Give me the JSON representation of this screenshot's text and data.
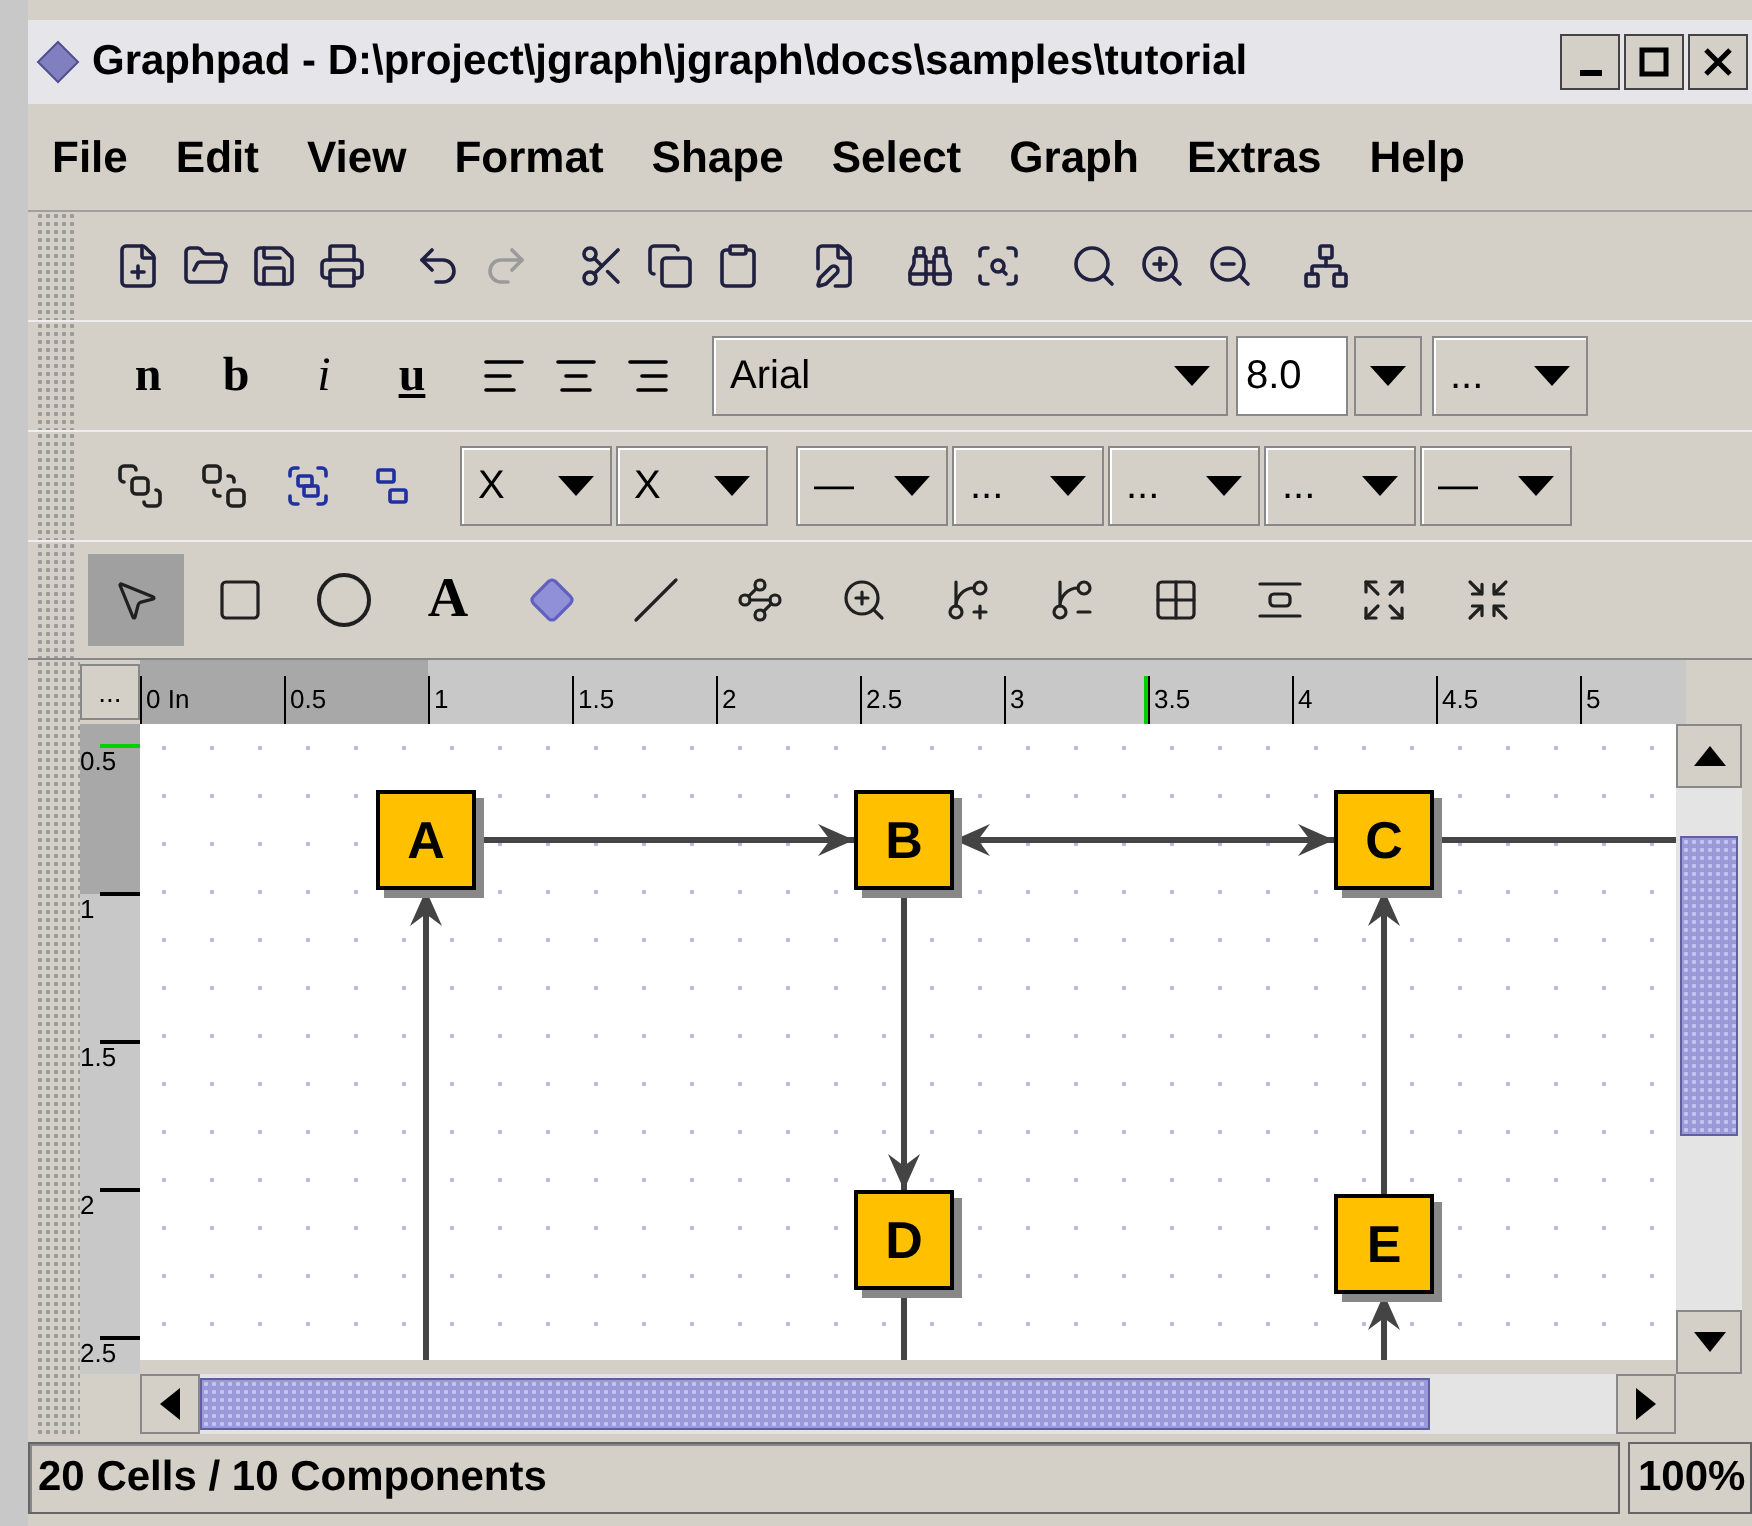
{
  "window": {
    "title": "Graphpad - D:\\project\\jgraph\\jgraph\\docs\\samples\\tutorial"
  },
  "menu": [
    "File",
    "Edit",
    "View",
    "Format",
    "Shape",
    "Select",
    "Graph",
    "Extras",
    "Help"
  ],
  "main_toolbar": [
    {
      "disabled": false
    },
    {
      "disabled": false
    },
    {
      "disabled": false
    },
    {
      "disabled": false
    },
    {
      "disabled": false
    },
    {
      "disabled": true
    },
    {
      "disabled": false
    },
    {
      "disabled": false
    },
    {
      "disabled": false
    },
    {
      "disabled": false
    },
    {
      "disabled": false
    },
    {
      "disabled": false
    },
    {
      "disabled": false
    },
    {
      "disabled": false
    },
    {
      "disabled": false
    },
    {
      "disabled": false
    }
  ],
  "format_toolbar": {
    "styles": [
      "n",
      "b",
      "i",
      "u"
    ],
    "font": "Arial",
    "size": "8.0",
    "size_more": "..."
  },
  "arrange_toolbar": {
    "combos": [
      "X",
      "X",
      "—",
      "...",
      "...",
      "...",
      "—"
    ]
  },
  "tools": [
    {
      "kind": "icon",
      "selected": true
    },
    {
      "kind": "icon",
      "selected": false
    },
    {
      "kind": "icon",
      "selected": false
    },
    {
      "kind": "text",
      "label": "A",
      "selected": false
    },
    {
      "kind": "icon",
      "selected": false
    },
    {
      "kind": "icon",
      "selected": false
    },
    {
      "kind": "icon",
      "selected": false
    },
    {
      "kind": "icon",
      "selected": false
    },
    {
      "kind": "icon",
      "selected": false
    },
    {
      "kind": "icon",
      "selected": false
    },
    {
      "kind": "icon",
      "selected": false
    },
    {
      "kind": "icon",
      "selected": false
    },
    {
      "kind": "icon",
      "selected": false
    },
    {
      "kind": "icon",
      "selected": false
    }
  ],
  "ruler": {
    "corner": "...",
    "x_labels": [
      "0 In",
      "0.5",
      "1",
      "1.5",
      "2",
      "2.5",
      "3",
      "3.5",
      "4",
      "4.5",
      "5"
    ],
    "y_labels": [
      "0.5",
      "1",
      "1.5",
      "2",
      "2.5"
    ]
  },
  "graph": {
    "nodes": [
      {
        "label": "A"
      },
      {
        "label": "B"
      },
      {
        "label": "C"
      },
      {
        "label": "D"
      },
      {
        "label": "E"
      }
    ]
  },
  "status_bar": {
    "text": "20 Cells / 10 Components",
    "zoom": "100%"
  }
}
